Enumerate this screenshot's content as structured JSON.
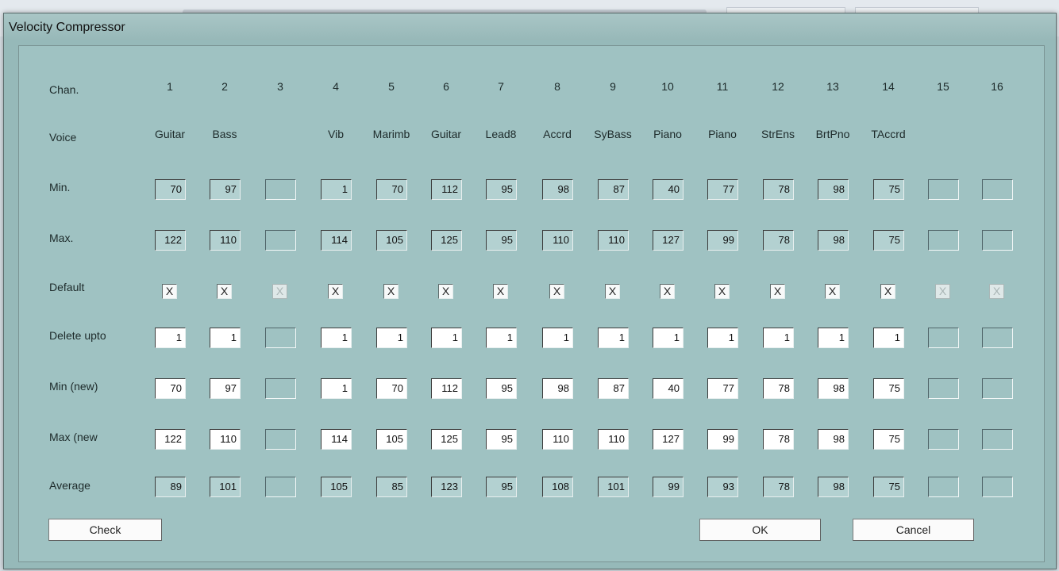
{
  "window": {
    "title": "Velocity Compressor"
  },
  "rows": [
    {
      "key": "chan",
      "label": "Chan."
    },
    {
      "key": "voice",
      "label": "Voice"
    },
    {
      "key": "min",
      "label": "Min."
    },
    {
      "key": "max",
      "label": "Max."
    },
    {
      "key": "default",
      "label": "Default"
    },
    {
      "key": "delete_upto",
      "label": "Delete upto"
    },
    {
      "key": "min_new",
      "label": "Min (new)"
    },
    {
      "key": "max_new",
      "label": "Max (new"
    },
    {
      "key": "average",
      "label": "Average"
    }
  ],
  "channels": [
    {
      "chan": "1",
      "voice": "Guitar",
      "min": "70",
      "max": "122",
      "default": "X",
      "default_enabled": true,
      "delete_upto": "1",
      "min_new": "70",
      "max_new": "122",
      "average": "89"
    },
    {
      "chan": "2",
      "voice": "Bass",
      "min": "97",
      "max": "110",
      "default": "X",
      "default_enabled": true,
      "delete_upto": "1",
      "min_new": "97",
      "max_new": "110",
      "average": "101"
    },
    {
      "chan": "3",
      "voice": "",
      "min": "",
      "max": "",
      "default": "X",
      "default_enabled": false,
      "delete_upto": "",
      "min_new": "",
      "max_new": "",
      "average": ""
    },
    {
      "chan": "4",
      "voice": "Vib",
      "min": "1",
      "max": "114",
      "default": "X",
      "default_enabled": true,
      "delete_upto": "1",
      "min_new": "1",
      "max_new": "114",
      "average": "105"
    },
    {
      "chan": "5",
      "voice": "Marimb",
      "min": "70",
      "max": "105",
      "default": "X",
      "default_enabled": true,
      "delete_upto": "1",
      "min_new": "70",
      "max_new": "105",
      "average": "85"
    },
    {
      "chan": "6",
      "voice": "Guitar",
      "min": "112",
      "max": "125",
      "default": "X",
      "default_enabled": true,
      "delete_upto": "1",
      "min_new": "112",
      "max_new": "125",
      "average": "123"
    },
    {
      "chan": "7",
      "voice": "Lead8",
      "min": "95",
      "max": "95",
      "default": "X",
      "default_enabled": true,
      "delete_upto": "1",
      "min_new": "95",
      "max_new": "95",
      "average": "95"
    },
    {
      "chan": "8",
      "voice": "Accrd",
      "min": "98",
      "max": "110",
      "default": "X",
      "default_enabled": true,
      "delete_upto": "1",
      "min_new": "98",
      "max_new": "110",
      "average": "108"
    },
    {
      "chan": "9",
      "voice": "SyBass",
      "min": "87",
      "max": "110",
      "default": "X",
      "default_enabled": true,
      "delete_upto": "1",
      "min_new": "87",
      "max_new": "110",
      "average": "101"
    },
    {
      "chan": "10",
      "voice": "Piano",
      "min": "40",
      "max": "127",
      "default": "X",
      "default_enabled": true,
      "delete_upto": "1",
      "min_new": "40",
      "max_new": "127",
      "average": "99"
    },
    {
      "chan": "11",
      "voice": "Piano",
      "min": "77",
      "max": "99",
      "default": "X",
      "default_enabled": true,
      "delete_upto": "1",
      "min_new": "77",
      "max_new": "99",
      "average": "93"
    },
    {
      "chan": "12",
      "voice": "StrEns",
      "min": "78",
      "max": "78",
      "default": "X",
      "default_enabled": true,
      "delete_upto": "1",
      "min_new": "78",
      "max_new": "78",
      "average": "78"
    },
    {
      "chan": "13",
      "voice": "BrtPno",
      "min": "98",
      "max": "98",
      "default": "X",
      "default_enabled": true,
      "delete_upto": "1",
      "min_new": "98",
      "max_new": "98",
      "average": "98"
    },
    {
      "chan": "14",
      "voice": "TAccrd",
      "min": "75",
      "max": "75",
      "default": "X",
      "default_enabled": true,
      "delete_upto": "1",
      "min_new": "75",
      "max_new": "75",
      "average": "75"
    },
    {
      "chan": "15",
      "voice": "",
      "min": "",
      "max": "",
      "default": "X",
      "default_enabled": false,
      "delete_upto": "",
      "min_new": "",
      "max_new": "",
      "average": ""
    },
    {
      "chan": "16",
      "voice": "",
      "min": "",
      "max": "",
      "default": "X",
      "default_enabled": false,
      "delete_upto": "",
      "min_new": "",
      "max_new": "",
      "average": ""
    }
  ],
  "buttons": {
    "check": "Check",
    "ok": "OK",
    "cancel": "Cancel"
  },
  "colors": {
    "dialog_bg": "#9fc2c2",
    "readonly_field": "#b3d1d1",
    "editable_field": "#ffffff"
  }
}
